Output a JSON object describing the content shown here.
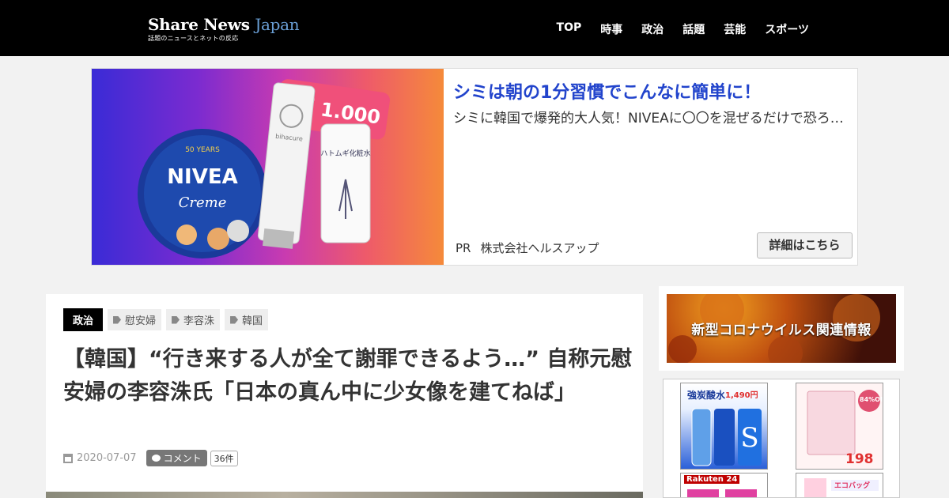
{
  "site": {
    "logo_main": "Share News",
    "logo_accent": "Japan",
    "logo_sub": "話題のニュースとネットの反応"
  },
  "nav": [
    "TOP",
    "時事",
    "政治",
    "話題",
    "芸能",
    "スポーツ"
  ],
  "ad": {
    "heart_count": "1.000",
    "title": "シミは朝の1分習慣でこんなに簡単に！",
    "description": "シミに韓国で爆発的大人気！NIVEAに〇〇を混ぜるだけで恐ろしい効果が…",
    "pr_label": "PR",
    "advertiser": "株式会社ヘルスアップ",
    "button": "詳細はこちら",
    "product_labels": [
      "NIVEA",
      "Creme",
      "bihacure",
      "ハトムギ化粧水",
      "50 YEARS"
    ]
  },
  "article": {
    "category": "政治",
    "tags": [
      "慰安婦",
      "李容洙",
      "韓国"
    ],
    "title": "【韓国】“行き来する人が全て謝罪できるよう…” 自称元慰安婦の李容洙氏「日本の真ん中に少女像を建てねば」",
    "date": "2020-07-07",
    "comment_label": "コメント",
    "comment_count": "36件"
  },
  "sidebar": {
    "covid_banner": "新型コロナウイルス関連情報",
    "ads": [
      {
        "label": "強炭酸水",
        "price": "1,490円"
      },
      {
        "label": "84%OFF",
        "price": "198円"
      },
      {
        "label": "Rakuten 24"
      },
      {
        "label": "エコバッグ"
      }
    ]
  },
  "colors": {
    "header_bg": "#000000",
    "ad_title": "#2244cc",
    "accent": "#6a9fd6"
  }
}
